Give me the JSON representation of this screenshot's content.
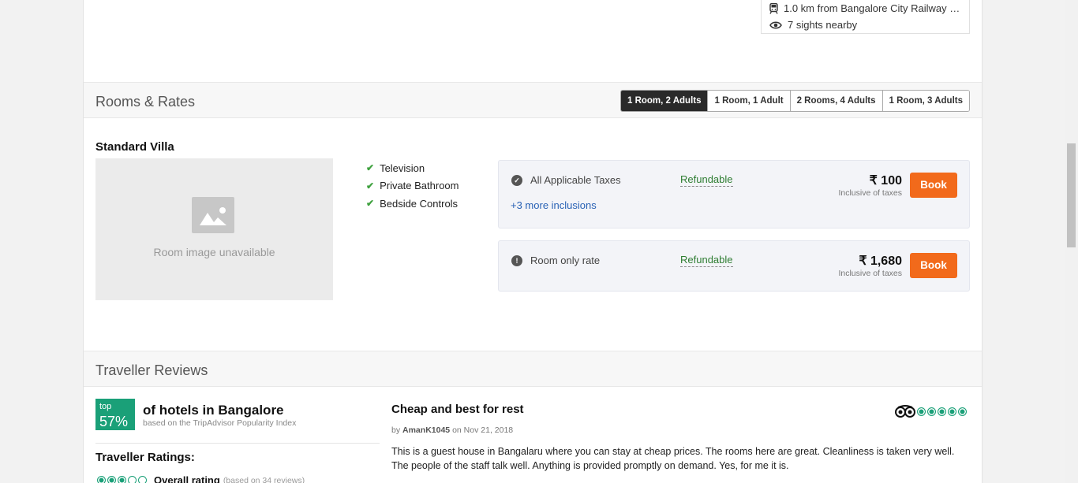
{
  "location": {
    "railway": "1.0 km from Bangalore City Railway S...",
    "sights": "7 sights nearby"
  },
  "rooms_section": {
    "title": "Rooms & Rates",
    "occupancy_tabs": [
      "1 Room, 2 Adults",
      "1 Room, 1 Adult",
      "2 Rooms, 4 Adults",
      "1 Room, 3 Adults"
    ],
    "active_tab": "1 Room, 2 Adults"
  },
  "room": {
    "name": "Standard Villa",
    "image_placeholder": "Room image unavailable",
    "amenities": [
      "Television",
      "Private Bathroom",
      "Bedside Controls"
    ],
    "rates": [
      {
        "name": "All Applicable Taxes",
        "policy": "Refundable",
        "price": "₹ 100",
        "tax_note": "Inclusive of taxes",
        "book_label": "Book",
        "more_link": "+3 more inclusions"
      },
      {
        "name": "Room only rate",
        "policy": "Refundable",
        "price": "₹ 1,680",
        "tax_note": "Inclusive of taxes",
        "book_label": "Book"
      }
    ]
  },
  "reviews_section": {
    "title": "Traveller Reviews",
    "rank": {
      "badge_top": "top",
      "badge_pct": "57%",
      "text": "of hotels in Bangalore",
      "subtext": "based on the TripAdvisor Popularity Index"
    },
    "ratings_title": "Traveller Ratings:",
    "overall": {
      "label": "Overall rating",
      "subtext": "(based on 34 reviews)",
      "circles_filled": 3.5,
      "circles_total": 5
    },
    "review": {
      "title": "Cheap and best for rest",
      "by_prefix": "by",
      "author": "AmanK1045",
      "date_prefix": "on",
      "date": "Nov 21, 2018",
      "body": "This is a guest house in Bangalaru where you can stay at cheap prices. The rooms here are great. Cleanliness is taken very well. The people of the staff talk well. Anything is provided promptly on demand. Yes, for me it is.",
      "rating": 5,
      "rating_total": 5
    }
  },
  "colors": {
    "accent": "#f26a1b",
    "tripadvisor_green": "#1aa078",
    "active_tab": "#2a2a2a",
    "link": "#2962b5",
    "refundable": "#2e7d32"
  }
}
